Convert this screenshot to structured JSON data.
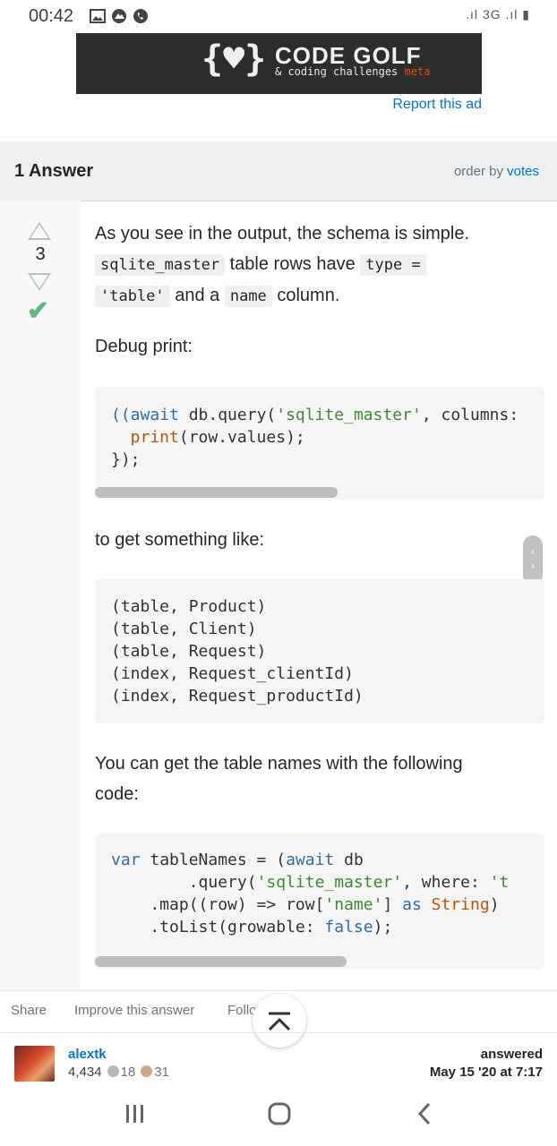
{
  "status": {
    "time": "00:42",
    "network": "3G"
  },
  "ad": {
    "logo": "{♥}",
    "title": "CODE GOLF",
    "subtitle": "& coding challenges",
    "meta": "meta",
    "report": "Report this ad"
  },
  "answers_header": {
    "count_label": "1 Answer",
    "order_prefix": "order by",
    "order_value": "votes"
  },
  "vote": {
    "count": "3"
  },
  "post": {
    "p1_a": "As you see in the output, the schema is simple.",
    "code1": "sqlite_master",
    "p1_b": "table rows have",
    "code2": "type =",
    "code3": "'table'",
    "p1_c": "and a",
    "code4": "name",
    "p1_d": "column.",
    "p2": "Debug print:",
    "p3": "to get something like:",
    "p4": "You can get the table names with the following",
    "p4b": "code:"
  },
  "code_block_1": {
    "l1_a": "(await",
    "l1_b": " db.query(",
    "l1_c": "'sqlite_master'",
    "l1_d": ", columns:",
    "l2_a": "  print",
    "l2_b": "(row.values);",
    "l3": "});"
  },
  "code_block_2": {
    "lines": [
      "(table, Product)",
      "(table, Client)",
      "(table, Request)",
      "(index, Request_clientId)",
      "(index, Request_productId)"
    ]
  },
  "code_block_3": {
    "l1_a": "var",
    "l1_b": " tableNames = (",
    "l1_c": "await",
    "l1_d": " db",
    "l2_a": "        .query(",
    "l2_b": "'sqlite_master'",
    "l2_c": ", where: ",
    "l2_d": "'t",
    "l3_a": "    .map((row) => row[",
    "l3_b": "'name'",
    "l3_c": "] ",
    "l3_d": "as",
    "l3_e": " ",
    "l3_f": "String",
    "l3_g": ")",
    "l4_a": "    .toList(growable: ",
    "l4_b": "false",
    "l4_c": ");"
  },
  "actions": {
    "share": "Share",
    "improve": "Improve this answer",
    "follow": "Follo"
  },
  "user": {
    "name": "alextk",
    "reputation": "4,434",
    "silver": "18",
    "bronze": "31",
    "answered_label": "answered",
    "answered_date": "May 15 '20 at 7:17"
  },
  "colors": {
    "link": "#0074cc",
    "accepted": "#5eba7d",
    "silver": "#b4b8bc",
    "bronze": "#d1a684"
  },
  "icons": {
    "back": "chevron-left-icon",
    "home": "home-icon",
    "recents": "recents-icon",
    "to_top": "scroll-to-top-icon"
  }
}
